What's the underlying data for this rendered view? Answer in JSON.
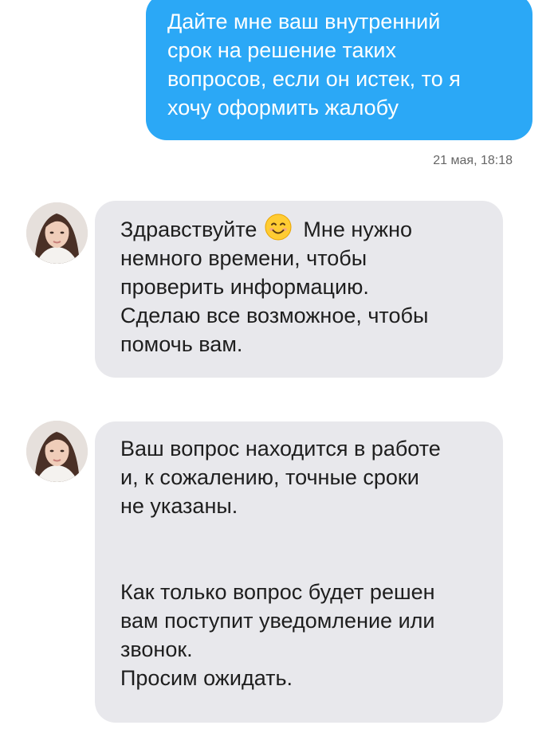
{
  "messages": [
    {
      "direction": "outgoing",
      "lines": [
        "Дайте мне ваш внутренний",
        "срок на решение таких",
        "вопросов, если он истек, то я",
        "хочу оформить жалобу"
      ],
      "timestamp": "21 мая, 18:18"
    },
    {
      "direction": "incoming",
      "avatar_icon": "agent-avatar",
      "greeting": "Здравствуйте",
      "emoji_icon": "smiling-face-emoji",
      "lines": [
        "Мне нужно",
        "немного времени, чтобы",
        "проверить информацию.",
        "Сделаю все возможное, чтобы",
        "помочь вам."
      ]
    },
    {
      "direction": "incoming",
      "avatar_icon": "agent-avatar",
      "paragraph1": [
        "Ваш вопрос находится в работе",
        "и, к сожалению, точные сроки",
        "не указаны."
      ],
      "paragraph2": [
        "Как только вопрос будет решен",
        "вам поступит уведомление или",
        "звонок.",
        "Просим ожидать."
      ]
    }
  ],
  "colors": {
    "outgoing_bubble": "#2ba8f6",
    "incoming_bubble": "#e8e8ec",
    "outgoing_text": "#ffffff",
    "incoming_text": "#1e1e1e",
    "timestamp": "#666666"
  }
}
